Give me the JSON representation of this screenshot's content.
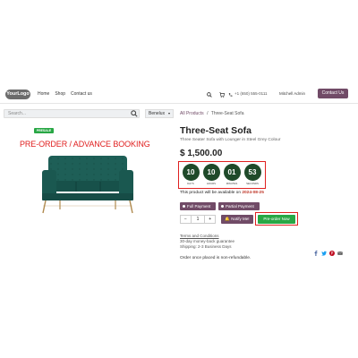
{
  "header": {
    "logo_text": "YourLogo",
    "nav": [
      "Home",
      "Shop",
      "Contact us"
    ],
    "phone": "+1 (650) 555-0111",
    "user": "Mitchell Admin",
    "contact_label": "Contact Us",
    "icons": [
      "search-icon",
      "cart-icon",
      "phone-icon"
    ]
  },
  "search": {
    "placeholder": "Search..."
  },
  "pricelist": {
    "selected": "Benelux"
  },
  "breadcrumb": {
    "root": "All Products",
    "separator": "/",
    "current": "Three-Seat Sofa"
  },
  "product": {
    "badge": "PRESALE",
    "banner": "PRE-ORDER / ADVANCE BOOKING",
    "title": "Three-Seat Sofa",
    "description": "Three Seater Sofa with Lounger in Steel Grey Colour",
    "price": "$ 1,500.00",
    "countdown": [
      {
        "value": "10",
        "label": "DAYS"
      },
      {
        "value": "10",
        "label": "HOURS"
      },
      {
        "value": "01",
        "label": "MINUTES"
      },
      {
        "value": "53",
        "label": "SECONDS"
      }
    ],
    "availability_text": "This product will be available on",
    "availability_date": "2024-08-25",
    "payment_options": [
      "Full Payment",
      "Partial Payment"
    ],
    "quantity": {
      "minus": "−",
      "value": "1",
      "plus": "+"
    },
    "notify_label": "Notify Me!",
    "preorder_label": "Pre-order Now",
    "terms_link": "Terms and Conditions",
    "guarantee": "30-day money-back guarantee",
    "shipping": "Shipping: 2-3 Business Days",
    "refund_note": "Order once placed is non-refundable.",
    "share_icons": [
      "facebook-icon",
      "twitter-icon",
      "pinterest-icon",
      "email-icon"
    ]
  },
  "colors": {
    "brand": "#714b67",
    "countdown": "#1f4a2a",
    "success": "#28a745",
    "highlight": "#e02020",
    "sofa": "#1e5f57",
    "facebook": "#3b5998",
    "twitter": "#1da1f2",
    "pinterest": "#bd081c"
  }
}
